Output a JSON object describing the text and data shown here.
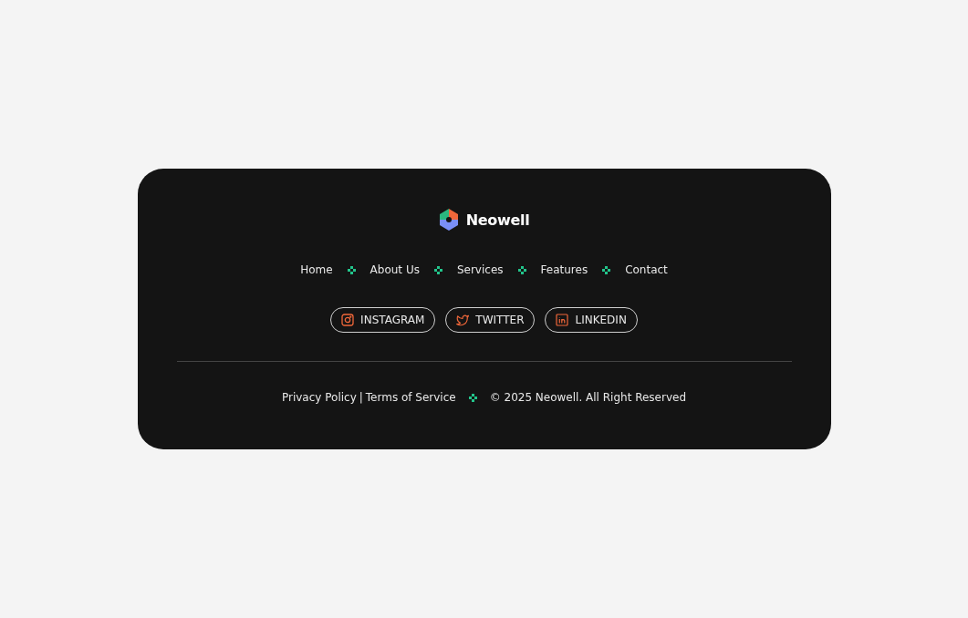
{
  "brand": {
    "name": "Neowell"
  },
  "nav": [
    {
      "label": "Home"
    },
    {
      "label": "About Us"
    },
    {
      "label": "Services"
    },
    {
      "label": "Features"
    },
    {
      "label": "Contact"
    }
  ],
  "social": [
    {
      "kind": "instagram",
      "label": "INSTAGRAM"
    },
    {
      "kind": "twitter",
      "label": "TWITTER"
    },
    {
      "kind": "linkedin",
      "label": "LINKEDIN"
    }
  ],
  "legal": {
    "links": [
      "Privacy Policy",
      "Terms of Service"
    ],
    "separator": "|",
    "copyright": "© 2025 Neowell. All Right Reserved"
  }
}
